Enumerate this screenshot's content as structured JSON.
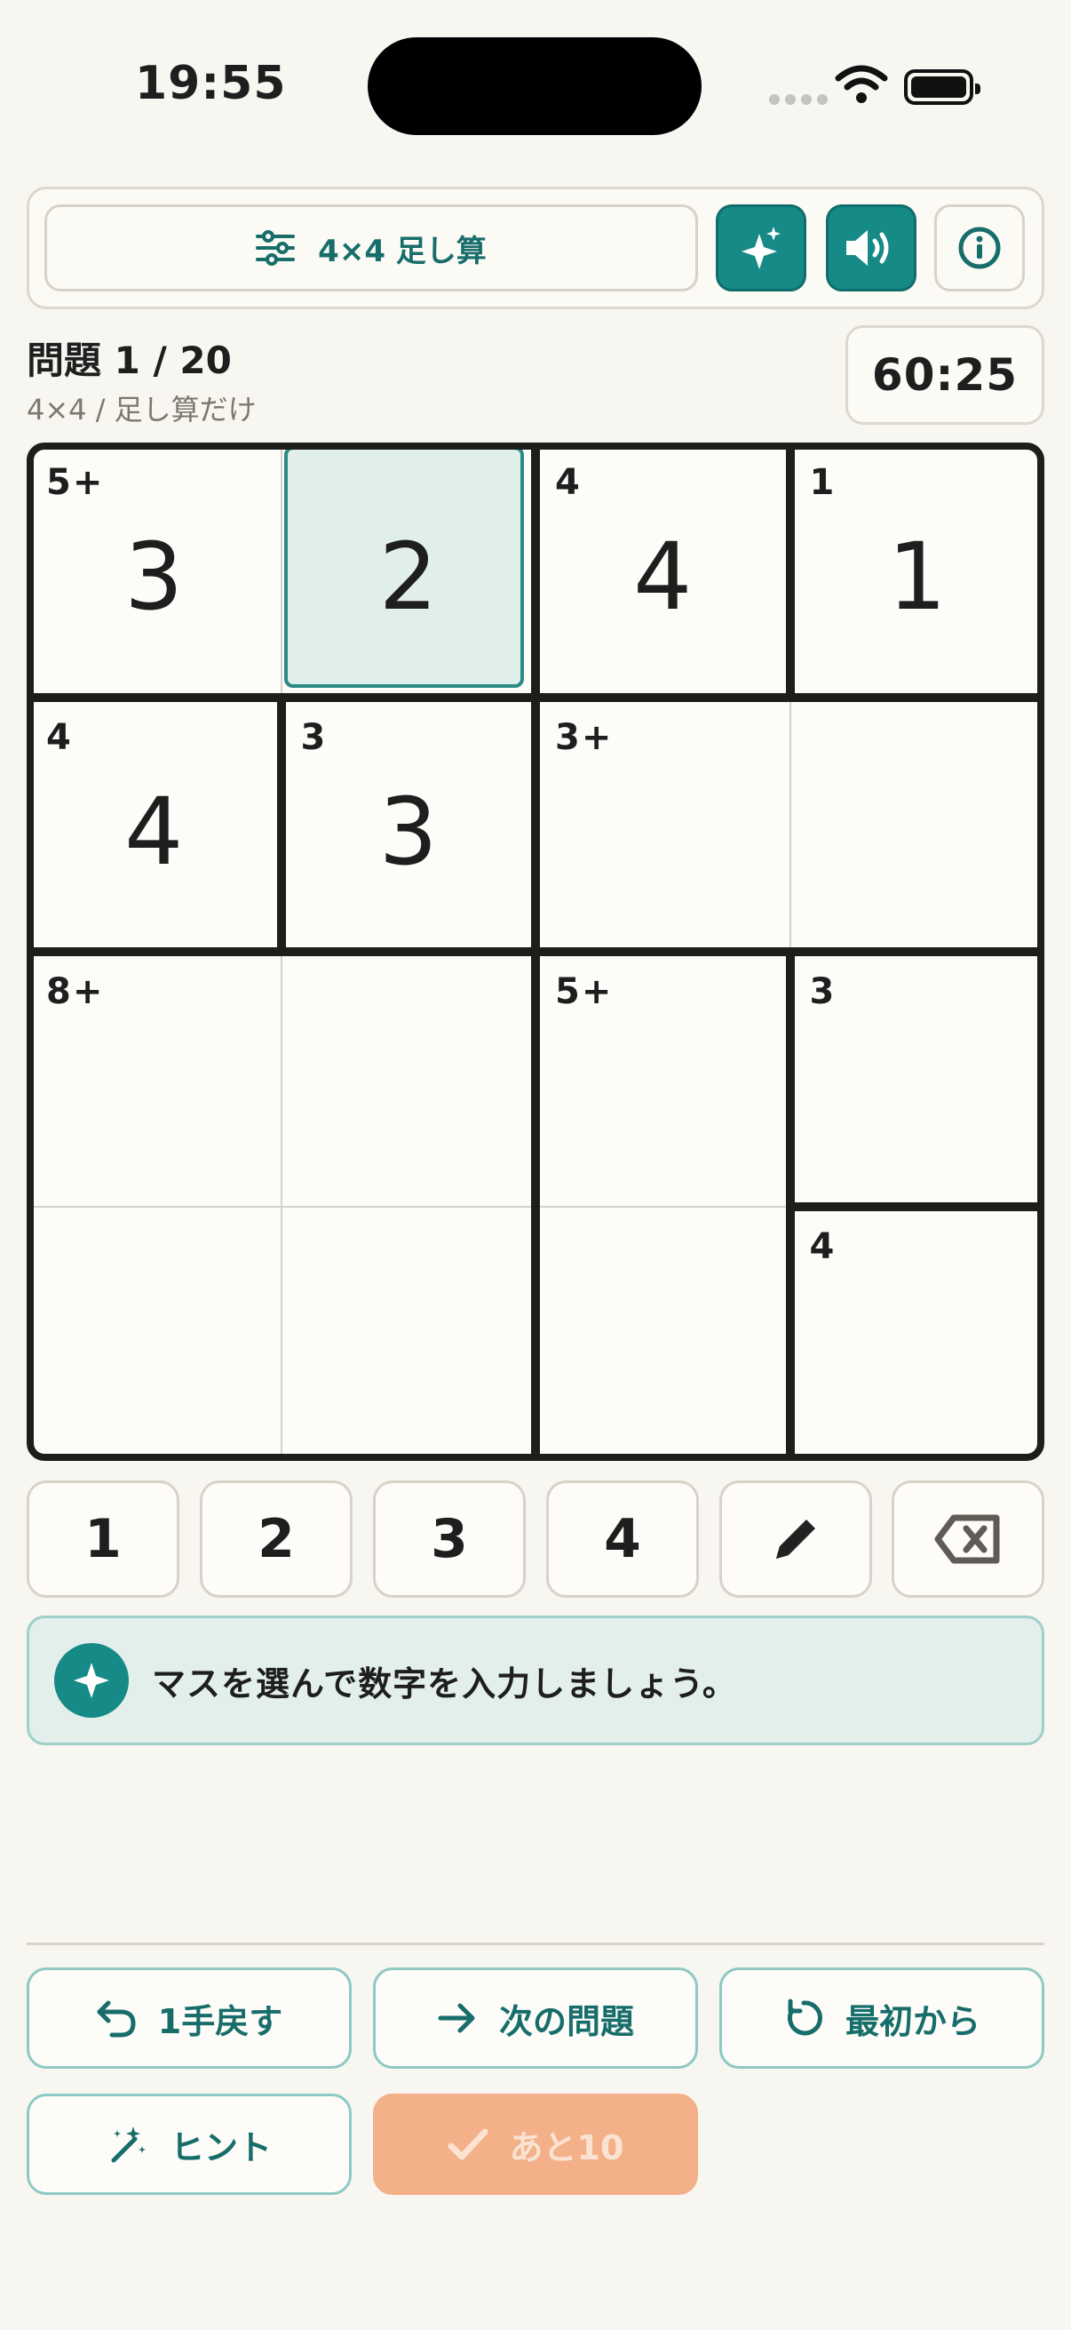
{
  "status_bar": {
    "time": "19:55"
  },
  "toolbar": {
    "mode_label": "4×4 足し算"
  },
  "header": {
    "problem": "問題 1 / 20",
    "subtitle": "4×4 / 足し算だけ",
    "timer": "60:25"
  },
  "board": {
    "size": 4,
    "selected_cell": [
      0,
      1
    ],
    "cells": [
      {
        "row": 0,
        "col": 0,
        "clue": "5+",
        "value": "3"
      },
      {
        "row": 0,
        "col": 1,
        "clue": "",
        "value": "2"
      },
      {
        "row": 0,
        "col": 2,
        "clue": "4",
        "value": "4"
      },
      {
        "row": 0,
        "col": 3,
        "clue": "1",
        "value": "1"
      },
      {
        "row": 1,
        "col": 0,
        "clue": "4",
        "value": "4"
      },
      {
        "row": 1,
        "col": 1,
        "clue": "3",
        "value": "3"
      },
      {
        "row": 1,
        "col": 2,
        "clue": "3+",
        "value": ""
      },
      {
        "row": 1,
        "col": 3,
        "clue": "",
        "value": ""
      },
      {
        "row": 2,
        "col": 0,
        "clue": "8+",
        "value": ""
      },
      {
        "row": 2,
        "col": 1,
        "clue": "",
        "value": ""
      },
      {
        "row": 2,
        "col": 2,
        "clue": "5+",
        "value": ""
      },
      {
        "row": 2,
        "col": 3,
        "clue": "3",
        "value": ""
      },
      {
        "row": 3,
        "col": 0,
        "clue": "",
        "value": ""
      },
      {
        "row": 3,
        "col": 1,
        "clue": "",
        "value": ""
      },
      {
        "row": 3,
        "col": 2,
        "clue": "",
        "value": ""
      },
      {
        "row": 3,
        "col": 3,
        "clue": "4",
        "value": ""
      }
    ]
  },
  "keypad": {
    "keys": [
      "1",
      "2",
      "3",
      "4"
    ],
    "pencil_icon": "pencil-icon",
    "delete_icon": "backspace-icon"
  },
  "message": "マスを選んで数字を入力しましょう。",
  "actions": {
    "undo": "1手戻す",
    "next": "次の問題",
    "restart": "最初から",
    "hint": "ヒント",
    "check": "あと10"
  },
  "colors": {
    "accent": "#168a86",
    "selected_cell": "#e1efeb",
    "check_disabled": "#f4b088"
  }
}
